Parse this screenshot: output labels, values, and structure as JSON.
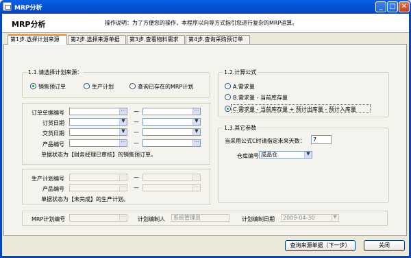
{
  "window": {
    "title": "MRP分析"
  },
  "header": {
    "title": "MRP分析",
    "description": "操作说明：为了方便您的操作，本程序以向导方式指引您进行复杂的MRP运算。"
  },
  "tabs": [
    {
      "label": "第1步.选择计划来源",
      "active": true
    },
    {
      "label": "第2步.选择来源单据",
      "active": false
    },
    {
      "label": "第3步.查看物料需求",
      "active": false
    },
    {
      "label": "第4步.查询采购预订单",
      "active": false
    }
  ],
  "source": {
    "title": "1.1.请选择计划来源：",
    "options": [
      {
        "label": "销售预订单",
        "selected": true
      },
      {
        "label": "生产计划",
        "selected": false
      },
      {
        "label": "查询已存在的MRP计划",
        "selected": false
      }
    ]
  },
  "sales_filter": {
    "rows": [
      {
        "label": "订单单据编号",
        "control": "lookup"
      },
      {
        "label": "订货日期",
        "control": "dropdown"
      },
      {
        "label": "交货日期",
        "control": "dropdown"
      },
      {
        "label": "产品编号",
        "control": "lookup"
      }
    ],
    "note": "单据状态为【财务经理已审核】的销售预订单。",
    "range_separator": "—"
  },
  "production_filter": {
    "rows": [
      {
        "label": "生产计划编号"
      },
      {
        "label": "产品编号"
      }
    ],
    "note": "单据状态为【未完成】的生产计划。"
  },
  "mrp_info": {
    "plan_no_label": "MRP计划编号",
    "planner_label": "计划编制人",
    "planner_value": "系统管理员",
    "plan_date_label": "计划编制日期",
    "plan_date_value": "2009-04-30"
  },
  "formula": {
    "title": "1.2.计算公式",
    "options": [
      {
        "label": "A.需求量",
        "selected": false
      },
      {
        "label": "B.需求量 - 当前库存量",
        "selected": false
      },
      {
        "label": "C.需求量 - 当前库存量 + 预计出库量 - 预计入库量",
        "selected": true
      }
    ]
  },
  "other": {
    "title": "1.3.其它参数",
    "days_label": "当采用公式C时请指定未来天数：",
    "days_value": "7",
    "warehouse_label": "仓库编号：",
    "warehouse_value": "成品仓"
  },
  "buttons": {
    "next": "查询来源单据（下一步）",
    "close": "关闭"
  },
  "glyphs": {
    "ellipsis": "···",
    "dropdown": "▼",
    "minimize": "_",
    "maximize": "□",
    "close": "✕"
  }
}
